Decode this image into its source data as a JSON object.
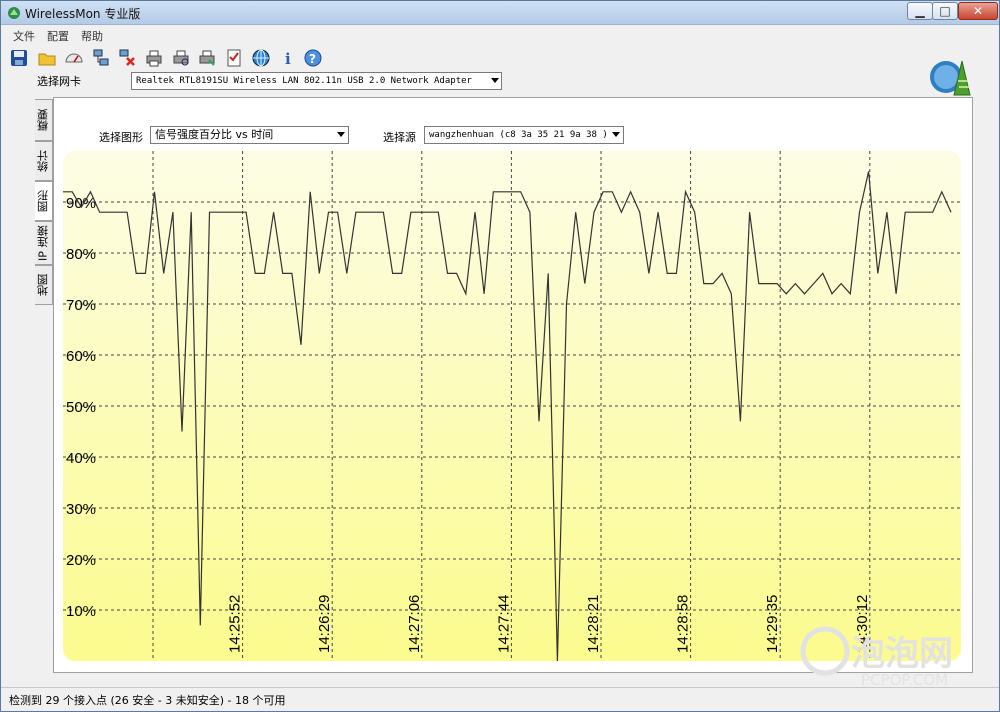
{
  "window": {
    "title": "WirelessMon 专业版"
  },
  "menu": [
    "文件",
    "配置",
    "帮助"
  ],
  "toolbar": [
    "save-icon",
    "open-folder-icon",
    "gauge-icon",
    "network-connect-icon",
    "network-disconnect-icon",
    "printer-icon",
    "print-preview-icon",
    "print-setup-icon",
    "checklist-icon",
    "globe-icon",
    "info-icon",
    "help-icon"
  ],
  "adapter": {
    "label": "选择网卡",
    "value": "Realtek RTL8191SU Wireless LAN 802.11n USB 2.0 Network Adapter"
  },
  "tabs": [
    "概要",
    "统计",
    "图形",
    "IP 连接",
    "地图"
  ],
  "active_tab": "图形",
  "graph": {
    "type_label": "选择图形",
    "type_value": "信号强度百分比 vs 时间",
    "source_label": "选择源",
    "source_value": "wangzhenhuan (c8 3a 35 21 9a 38 )"
  },
  "status": {
    "text": "检测到 29 个接入点 (26 安全 - 3 未知安全) - 18 个可用"
  },
  "watermark": {
    "brand": "泡泡网",
    "site": "PCPOP.COM"
  },
  "chart_data": {
    "type": "line",
    "ylim": [
      0,
      100
    ],
    "yticks": [
      "10%",
      "20%",
      "30%",
      "40%",
      "50%",
      "60%",
      "70%",
      "80%",
      "90%"
    ],
    "xticks": [
      "14:25:52",
      "14:26:29",
      "14:27:06",
      "14:27:44",
      "14:28:21",
      "14:28:58",
      "14:29:35",
      "14:30:12"
    ],
    "grid": true,
    "line_color": "#333333",
    "bg_top": "#fdfde6",
    "bg_bottom": "#fbfb8e",
    "series": [
      {
        "values": [
          92,
          92,
          89,
          92,
          88,
          88,
          88,
          88,
          76,
          76,
          92,
          76,
          88,
          45,
          88,
          7,
          88,
          88,
          88,
          88,
          88,
          76,
          76,
          88,
          76,
          76,
          62,
          92,
          76,
          88,
          88,
          76,
          88,
          88,
          88,
          88,
          76,
          76,
          88,
          88,
          88,
          88,
          76,
          76,
          72,
          88,
          72,
          92,
          92,
          92,
          92,
          88,
          47,
          76,
          0,
          70,
          88,
          74,
          88,
          92,
          92,
          88,
          92,
          88,
          76,
          88,
          76,
          76,
          92,
          88,
          74,
          74,
          76,
          72,
          47,
          88,
          74,
          74,
          74,
          72,
          74,
          72,
          74,
          76,
          72,
          74,
          72,
          88,
          96,
          76,
          88,
          72,
          88,
          88,
          88,
          88,
          92,
          88
        ]
      }
    ]
  }
}
